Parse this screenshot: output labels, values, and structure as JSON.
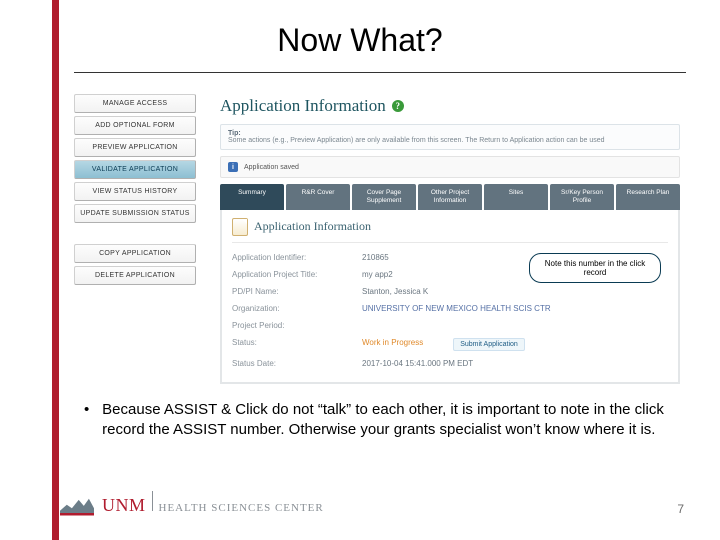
{
  "slide": {
    "title": "Now What?",
    "page_number": "7"
  },
  "sidebar": {
    "group1": [
      "MANAGE ACCESS",
      "ADD OPTIONAL FORM",
      "PREVIEW APPLICATION",
      "VALIDATE APPLICATION",
      "VIEW STATUS HISTORY",
      "UPDATE SUBMISSION STATUS"
    ],
    "group2": [
      "COPY APPLICATION",
      "DELETE APPLICATION"
    ]
  },
  "panel": {
    "title": "Application Information",
    "help_icon": "?",
    "tip_label": "Tip:",
    "tip_text": "Some actions (e.g., Preview Application) are only available from this screen. The Return to Application action can be used",
    "saved_icon": "i",
    "saved_text": "Application saved",
    "tabs": [
      "Summary",
      "R&R Cover",
      "Cover Page Supplement",
      "Other Project Information",
      "Sites",
      "Sr/Key Person Profile",
      "Research Plan"
    ],
    "form_heading": "Application Information",
    "rows": [
      {
        "label": "Application Identifier:",
        "value": "210865"
      },
      {
        "label": "Application Project Title:",
        "value": "my app2"
      },
      {
        "label": "PD/PI Name:",
        "value": "Stanton, Jessica K"
      },
      {
        "label": "Organization:",
        "value": "UNIVERSITY OF NEW MEXICO HEALTH SCIS CTR"
      },
      {
        "label": "Project Period:",
        "value": ""
      },
      {
        "label": "Status:",
        "value": "Work in Progress"
      },
      {
        "label": "Status Date:",
        "value": "2017-10-04 15:41.000 PM EDT"
      }
    ],
    "submit_label": "Submit Application"
  },
  "callout": {
    "text": "Note this number in the click record"
  },
  "bullet": {
    "text": "Because ASSIST & Click do not “talk” to each other, it is important to note in the click record the ASSIST number. Otherwise your grants specialist won’t know where it is."
  },
  "footer": {
    "unm": "UNM",
    "hsc": "HEALTH SCIENCES CENTER"
  }
}
